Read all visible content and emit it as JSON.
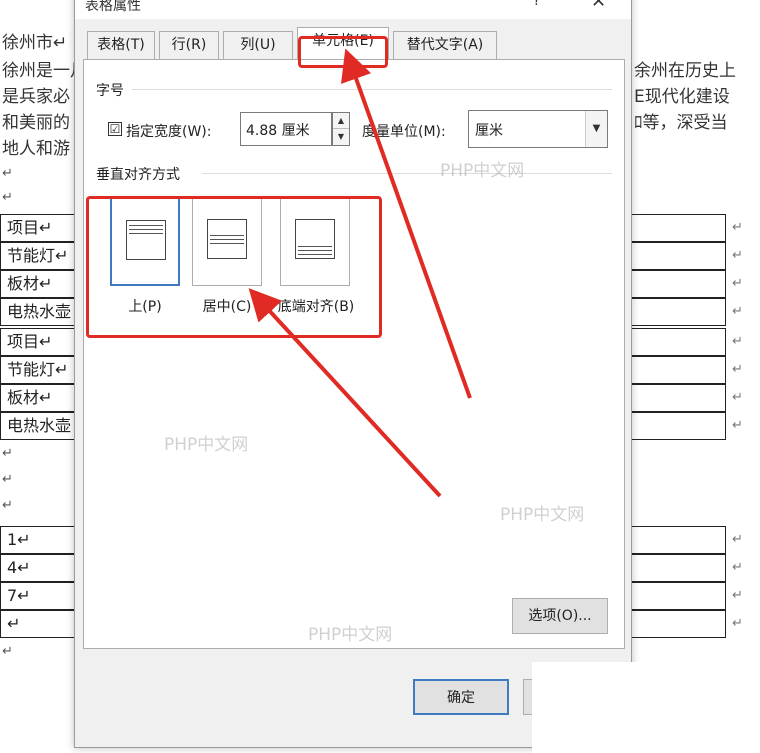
{
  "document": {
    "lines": [
      "徐州市↵",
      "徐州是一月",
      "是兵家必",
      "和美丽的",
      "地人和游",
      "↵",
      "↵"
    ],
    "right_text": [
      "余州在历史上",
      "E现代化建设",
      "ﾛ等，深受当"
    ],
    "table1_rows": [
      "项目↵",
      "节能灯↵",
      "板材↵",
      "电热水壶",
      "项目↵",
      "节能灯↵",
      "板材↵",
      "电热水壶"
    ],
    "table2_rows": [
      "1↵",
      "4↵",
      "7↵",
      "↵"
    ],
    "row_mark": "↵",
    "after_table_marks": [
      "↵",
      "↵",
      "↵"
    ],
    "end_mark": "↵"
  },
  "dialog": {
    "title": "表格属性",
    "help": "?",
    "close": "✕",
    "tabs": [
      {
        "label": "表格(T)"
      },
      {
        "label": "行(R)"
      },
      {
        "label": "列(U)"
      },
      {
        "label": "单元格(E)"
      },
      {
        "label": "替代文字(A)"
      }
    ],
    "size_group": "字号",
    "specify_width_label": "指定宽度(W):",
    "specify_width_checked": "☑",
    "width_value": "4.88 厘米",
    "measure_label": "度量单位(M):",
    "measure_value": "厘米",
    "valign_group": "垂直对齐方式",
    "valign_options": [
      {
        "label": "上(P)"
      },
      {
        "label": "居中(C)"
      },
      {
        "label": "底端对齐(B)"
      }
    ],
    "options_button": "选项(O)...",
    "ok_button": "确定"
  },
  "watermarks": [
    "PHP中文网",
    "PHP中文网",
    "PHP中文网",
    "PHP中文网"
  ],
  "colors": {
    "highlight": "#e02b25",
    "selected": "#3e7bc0"
  }
}
